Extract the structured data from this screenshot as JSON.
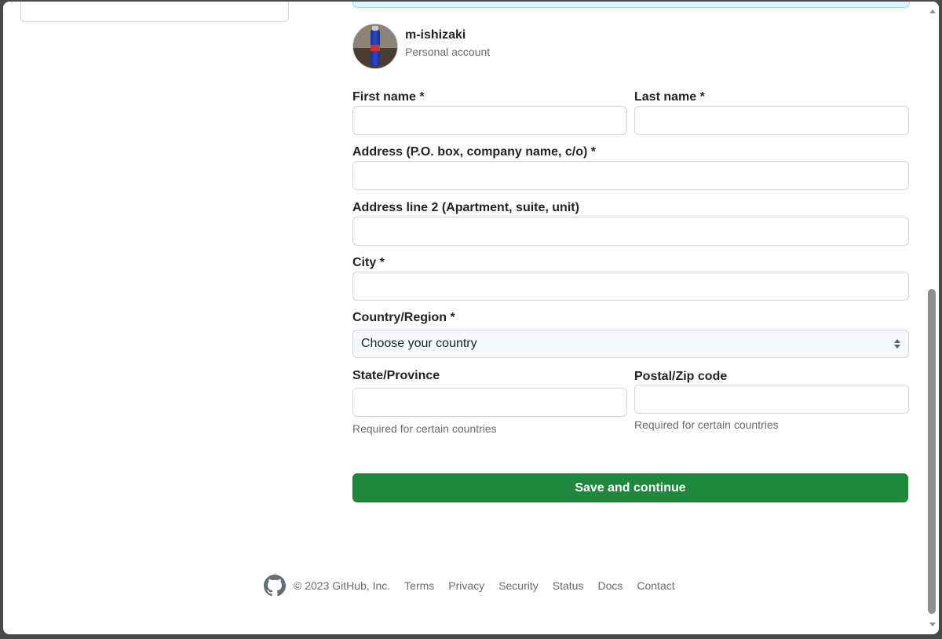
{
  "account": {
    "username": "m-ishizaki",
    "type": "Personal account"
  },
  "form": {
    "first_name_label": "First name *",
    "first_name_value": "",
    "last_name_label": "Last name *",
    "last_name_value": "",
    "address_label": "Address (P.O. box, company name, c/o) *",
    "address_value": "",
    "address2_label": "Address line 2 (Apartment, suite, unit)",
    "address2_value": "",
    "city_label": "City *",
    "city_value": "",
    "country_label": "Country/Region *",
    "country_selected": "Choose your country",
    "state_label": "State/Province",
    "state_value": "",
    "state_hint": "Required for certain countries",
    "postal_label": "Postal/Zip code",
    "postal_value": "",
    "postal_hint": "Required for certain countries",
    "save_label": "Save and continue"
  },
  "footer": {
    "copyright": "© 2023 GitHub, Inc.",
    "links": [
      "Terms",
      "Privacy",
      "Security",
      "Status",
      "Docs",
      "Contact"
    ]
  },
  "colors": {
    "primary_button": "#1f883d",
    "muted_text": "#656d76",
    "border": "#d0d7de"
  },
  "icons": {
    "footer_logo": "github-mark-icon",
    "select_arrows": "select-arrows-icon"
  }
}
